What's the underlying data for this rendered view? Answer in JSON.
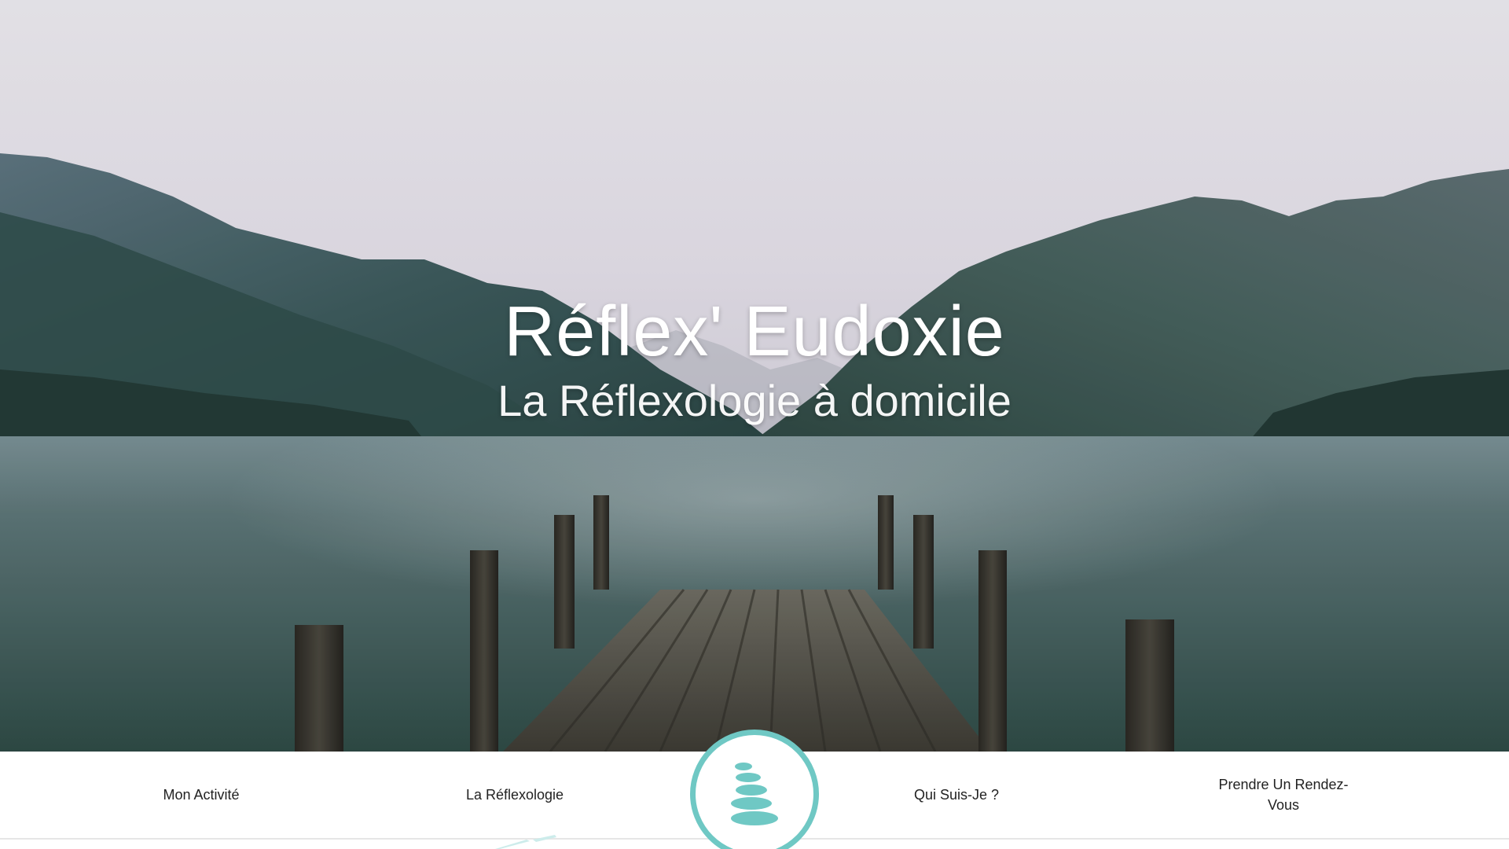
{
  "hero": {
    "title": "Réflex' Eudoxie",
    "subtitle": "La Réflexologie à domicile",
    "background": "lake-dock-mountains-image"
  },
  "nav": {
    "items": [
      {
        "label": "Mon Activité"
      },
      {
        "label": "La Réflexologie"
      },
      {
        "label": "Qui Suis-Je ?"
      },
      {
        "label": "Prendre Un Rendez-Vous"
      }
    ],
    "logo": "stacked-stones-icon"
  },
  "colors": {
    "accent": "#6fc8c4",
    "nav_text": "#222222",
    "nav_background": "#ffffff",
    "hero_text": "#ffffff"
  }
}
